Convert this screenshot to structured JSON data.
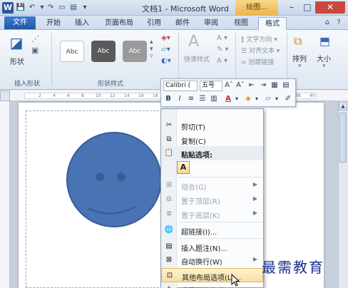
{
  "titlebar": {
    "logo": "W",
    "doc_title": "文档1 - Microsoft Word",
    "drawing_tools": "绘图...",
    "minimize": "–",
    "maximize": "□",
    "close": "✕"
  },
  "tabs": {
    "file": "文件",
    "items": [
      "开始",
      "插入",
      "页面布局",
      "引用",
      "邮件",
      "审阅",
      "视图",
      "格式"
    ]
  },
  "ribbon": {
    "insert_shapes": {
      "label": "插入形状",
      "shape_button": "形状"
    },
    "shape_styles": {
      "label": "形状样式",
      "swatches": [
        "Abc",
        "Abc",
        "Abc"
      ]
    },
    "quick_styles": "快速样式",
    "text": {
      "direction": "文字方向",
      "align": "对齐文本",
      "link": "创建链接"
    },
    "arrange": "排列",
    "size": "大小"
  },
  "mini_toolbar": {
    "font": "Calibri (",
    "size": "五号",
    "bold": "B",
    "italic": "I",
    "font_color_letter": "A"
  },
  "ruler": {
    "ticks": [
      "2",
      "4",
      "6",
      "8",
      "10",
      "12",
      "14",
      "16",
      "18",
      "20",
      "22",
      "24",
      "26",
      "28",
      "30",
      "32",
      "34",
      "36",
      "38",
      "40"
    ]
  },
  "context_menu": {
    "cut": "剪切(T)",
    "copy": "复制(C)",
    "paste_options": "粘贴选项:",
    "paste_option_a": "A",
    "group": "组合(G)",
    "bring_front": "置于顶层(R)",
    "send_back": "置于底层(K)",
    "hyperlink": "超链接(I)...",
    "insert_caption": "插入题注(N)...",
    "wrap_text": "自动换行(W)",
    "more_layout": "其他布局选项(L)...",
    "format_shape": "设置形状格式(O)..."
  },
  "watermark": "最需教育",
  "colors": {
    "smiley_fill": "#4a73b5",
    "smiley_stroke": "#3a5c94",
    "file_tab": "#2b62b5",
    "highlight": "#f7dea0"
  }
}
